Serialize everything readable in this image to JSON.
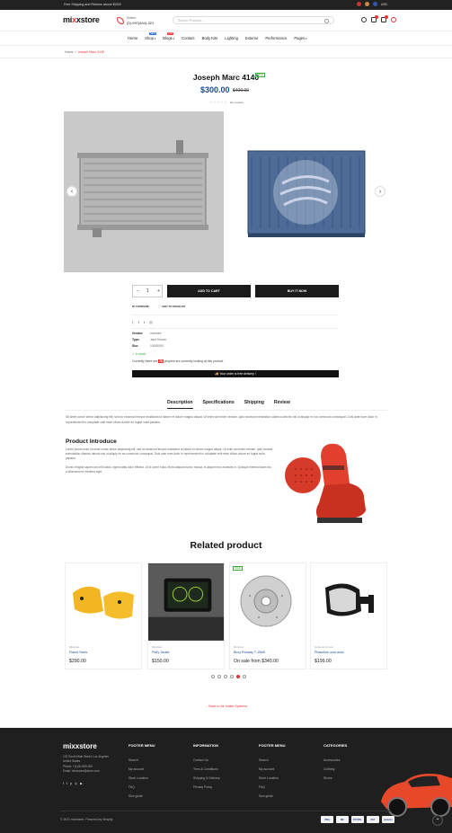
{
  "topbar": {
    "shipping": "Free Shipping and Returns above $200!",
    "currency": "USD"
  },
  "header": {
    "logo_a": "mi",
    "logo_x": "x",
    "logo_b": "xstore",
    "hotline_label": "Hotline:",
    "hotline_number": "(0)-997(604)-321",
    "search_placeholder": "Search Products..."
  },
  "nav": {
    "items": [
      {
        "label": "Home"
      },
      {
        "label": "Shop",
        "tag": "NEW"
      },
      {
        "label": "Blogs",
        "tag": "HOT"
      },
      {
        "label": "Contact"
      },
      {
        "label": "Body Kits"
      },
      {
        "label": "Lighting"
      },
      {
        "label": "Exterior"
      },
      {
        "label": "Performance"
      },
      {
        "label": "Pages"
      }
    ]
  },
  "breadcrumb": {
    "home": "Home",
    "separator": "/",
    "current": "Joseph Marc 4140"
  },
  "product": {
    "title": "Joseph Marc 4140",
    "sale_badge": "SALE",
    "price": "$300.00",
    "old_price": "$400.00",
    "stars": "☆☆☆☆☆",
    "reviews": "No reviews",
    "qty": "1",
    "add_to_cart": "ADD TO CART",
    "buy_now": "BUY IT NOW",
    "compare": "COMPARE",
    "wishlist": "ADD TO WISHLIST",
    "meta": [
      {
        "label": "Vendor:",
        "value": "mixxtore"
      },
      {
        "label": "Type:",
        "value": "Jane Kenzie"
      },
      {
        "label": "Sku:",
        "value": "10000050"
      }
    ],
    "in_stock": "In stock",
    "people_pre": "Currently there are",
    "people_count": "28",
    "people_post": "peoples are currently looking at this product",
    "free_delivery": "Your order is free delivery !"
  },
  "tabs": [
    "Description",
    "Specifications",
    "Shipping",
    "Review"
  ],
  "description": "Sit amet conse ctetur adipisicing elit, sed do eiusmod tempor incididunt ut labore et dolore magna aliqua. Ut enim ad minim veniam, quis nostrud exercitation ullamco laboris nisi ut aliquip ex ea commodo consequat. Duis aute irure dolor in reprehenderit in voluptate velit esse cillum dolore eu fugiat nulla pariatur.",
  "intro": {
    "heading": "Product Introduce",
    "p1": "Lorem ipsum dolor sit amet conse ctetur adipisicing elit, sed do eiusmod tempor incididunt ut labore et dolore magna aliqua. Ut enim ad minim veniam, quis nostrud exercitation ullamco laboris nisi ut aliquip ex ea commodo consequat. Duis aute irure dolor in reprehenderit in voluptate velit esse cillum dolore eu fugiat nulla pariatur.",
    "p2": "Donec fringilla sapien sed elit luctus, eget mattis dolor efficitur. Ut id lorem nulla. Morbi aliquam tortor massa, in aliquet eros molestie in. Quisque eleifend diam leo, a bibendum mi eleifend eget."
  },
  "related": {
    "heading": "Related product",
    "cards": [
      {
        "vendor": "Mixxtore",
        "name": "Flared Skirts",
        "price": "$290.00"
      },
      {
        "vendor": "Mixxtore",
        "name": "Puffy Jacket",
        "price": "$150.00"
      },
      {
        "vendor": "Mixxtore",
        "name": "Bicry Runway T-1560t",
        "price": "On sale from $340.00",
        "sale": "SALE"
      },
      {
        "vendor": "Coles and Leon",
        "name": "Phasellus urna dolor",
        "price": "$199.00"
      }
    ],
    "back": "← Back to Air Intake Systems"
  },
  "footer": {
    "logo": "mixxstore",
    "info": [
      "123 South Main Street, Los Angeles",
      "United States",
      "Phone: +(1)00-809-900",
      "Email: mixxstore@store.com"
    ],
    "columns": [
      {
        "title": "FOOTER MENU",
        "items": [
          "Search",
          "My account",
          "Store Location",
          "FAQ",
          "Size guide"
        ]
      },
      {
        "title": "INFORMATION",
        "items": [
          "Contact Us",
          "Term & Conditions",
          "Shipping & Delivery",
          "Privacy Policy"
        ]
      },
      {
        "title": "FOOTER MENU",
        "items": [
          "Search",
          "My account",
          "Store Location",
          "FAQ",
          "Size guide"
        ]
      },
      {
        "title": "CATEGORIES",
        "items": [
          "Accessories",
          "Clothing",
          "Shoes"
        ]
      }
    ],
    "copyright": "© 2021 mixxstore. Powered by Shopify",
    "payments": [
      "VISA",
      "MC",
      "PAYPAL",
      "PAY",
      "amazon"
    ]
  },
  "colors": {
    "accent": "#e53333",
    "price": "#1a4d8f",
    "footer": "#1f1f1f"
  }
}
